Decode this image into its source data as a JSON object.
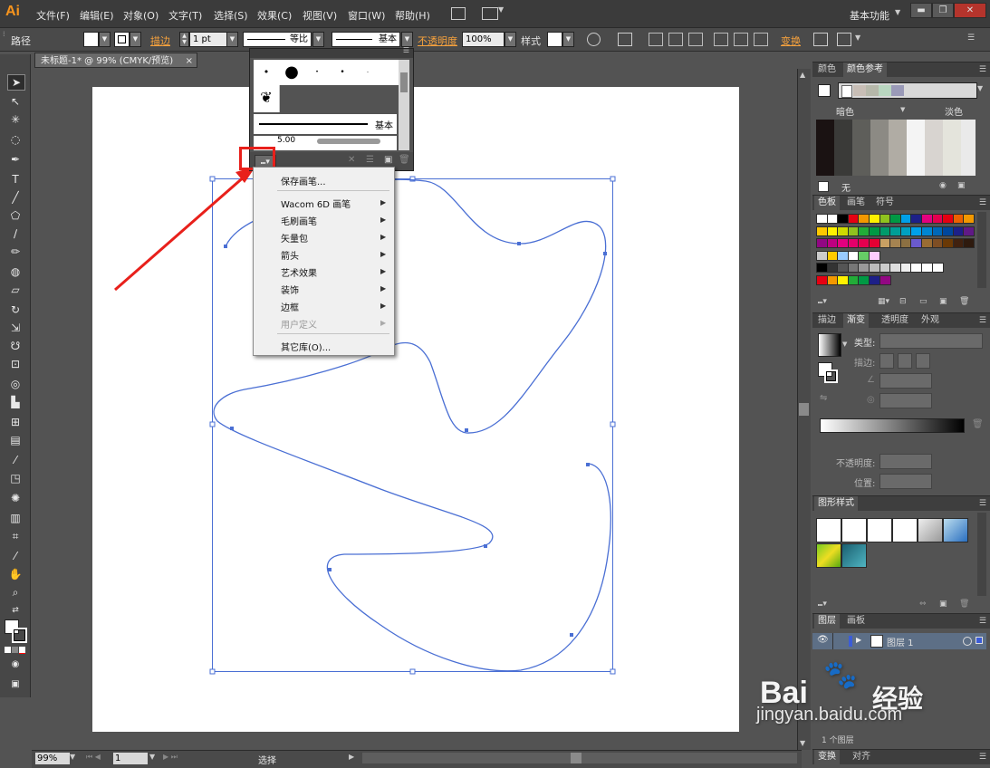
{
  "app": {
    "logo": "Ai"
  },
  "menu": [
    "文件(F)",
    "编辑(E)",
    "对象(O)",
    "文字(T)",
    "选择(S)",
    "效果(C)",
    "视图(V)",
    "窗口(W)",
    "帮助(H)"
  ],
  "workspace": "基本功能",
  "control_bar": {
    "object_type": "路径",
    "stroke_label": "描边",
    "stroke_weight": "1 pt",
    "profile": "等比",
    "brush": "基本",
    "opacity_label": "不透明度",
    "opacity": "100%",
    "style_label": "样式",
    "transform_label": "变换"
  },
  "document_tab": "未标题-1* @ 99% (CMYK/预览)",
  "brush_panel": {
    "brush_size_label": "5.00",
    "basic_label": "基本"
  },
  "brush_library_menu": {
    "items": [
      {
        "label": "保存画笔...",
        "submenu": false,
        "disabled": false
      },
      {
        "label": "Wacom 6D 画笔",
        "submenu": true,
        "disabled": false
      },
      {
        "label": "毛刷画笔",
        "submenu": true,
        "disabled": false
      },
      {
        "label": "矢量包",
        "submenu": true,
        "disabled": false
      },
      {
        "label": "箭头",
        "submenu": true,
        "disabled": false
      },
      {
        "label": "艺术效果",
        "submenu": true,
        "disabled": false
      },
      {
        "label": "装饰",
        "submenu": true,
        "disabled": false
      },
      {
        "label": "边框",
        "submenu": true,
        "disabled": false
      },
      {
        "label": "用户定义",
        "submenu": true,
        "disabled": true
      },
      {
        "label": "其它库(O)...",
        "submenu": false,
        "disabled": false
      }
    ]
  },
  "color_guide_panel": {
    "tabs": [
      "颜色",
      "颜色参考"
    ],
    "dark_label": "暗色",
    "light_label": "淡色",
    "none_label": "无"
  },
  "swatches_panel": {
    "tabs": [
      "色板",
      "画笔",
      "符号"
    ]
  },
  "gradient_panel": {
    "tabs": [
      "描边",
      "渐变",
      "透明度",
      "外观"
    ],
    "type_label": "类型:",
    "stroke_label": "描边:",
    "opacity_label": "不透明度:",
    "position_label": "位置:"
  },
  "graphic_styles_panel": {
    "tab": "图形样式"
  },
  "layers_panel": {
    "tabs": [
      "图层",
      "画板"
    ],
    "layer_name": "图层 1",
    "footer": "1 个图层"
  },
  "bottom_panel": {
    "tabs": [
      "变换",
      "对齐"
    ]
  },
  "status_bar": {
    "zoom": "99%",
    "page": "1",
    "mode": "选择"
  },
  "watermark": {
    "brand": "Bai",
    "brand_cn": "经验",
    "url": "jingyan.baidu.com"
  },
  "colors": {
    "accent_orange": "#f7941d",
    "highlight_red": "#e8201b",
    "path_blue": "#4a6fd4"
  }
}
